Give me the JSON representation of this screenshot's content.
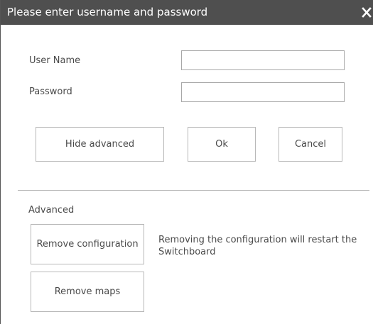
{
  "dialog": {
    "title": "Please enter username and password",
    "close_icon": "close-icon"
  },
  "login": {
    "username_label": "User Name",
    "username_value": "",
    "password_label": "Password",
    "password_value": ""
  },
  "actions": {
    "hide_advanced": "Hide advanced",
    "ok": "Ok",
    "cancel": "Cancel"
  },
  "advanced": {
    "heading": "Advanced",
    "remove_configuration": "Remove configuration",
    "remove_configuration_note": "Removing the configuration will restart the Switchboard",
    "remove_maps": "Remove maps"
  },
  "colors": {
    "titlebar_bg": "#4f4f4f",
    "titlebar_text": "#ffffff",
    "border": "#b8b8b8",
    "text": "#4a4a4a"
  }
}
